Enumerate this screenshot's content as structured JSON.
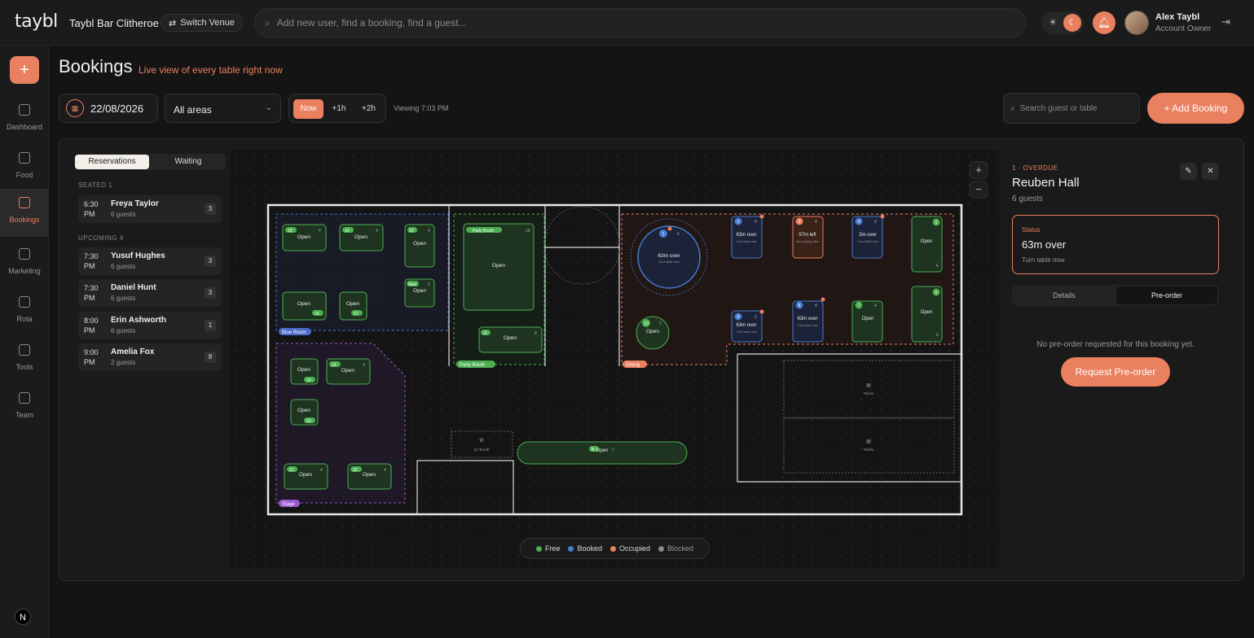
{
  "app": {
    "logo": "taybl",
    "venue": "Taybl Bar Clitheroe",
    "switch_label": "Switch Venue"
  },
  "search": {
    "placeholder": "Add new user, find a booking, find a guest..."
  },
  "user": {
    "name": "Alex Taybl",
    "role": "Account Owner"
  },
  "colors": {
    "accent": "#e9805f",
    "free": "#4caf50",
    "booked": "#4a7bd0",
    "occupied": "#e9805f",
    "blocked": "#888888"
  },
  "sidebar": {
    "add_label": "+",
    "items": [
      {
        "label": "Dashboard",
        "icon": "dashboard-icon"
      },
      {
        "label": "Food",
        "icon": "food-icon"
      },
      {
        "label": "Bookings",
        "icon": "bookings-icon",
        "active": true
      },
      {
        "label": "Marketing",
        "icon": "megaphone-icon"
      },
      {
        "label": "Rota",
        "icon": "rota-icon"
      },
      {
        "label": "Tools",
        "icon": "tools-icon"
      },
      {
        "label": "Team",
        "icon": "team-icon"
      }
    ],
    "bottom_badge": "N"
  },
  "page": {
    "title": "Bookings",
    "subtitle": "Live view of every table right now"
  },
  "toolbar": {
    "date": "22/08/2026",
    "area": "All areas",
    "times": [
      "Now",
      "+1h",
      "+2h"
    ],
    "viewing": "Viewing 7:03 PM",
    "search_placeholder": "Search guest or table",
    "add_booking": "+ Add Booking"
  },
  "reservations": {
    "tabs": [
      "Reservations",
      "Waiting"
    ],
    "seated_header": "SEATED 1",
    "upcoming_header": "UPCOMING 4",
    "seated": [
      {
        "time": "6:30 PM",
        "name": "Freya Taylor",
        "guests": "6 guests",
        "count": "3"
      }
    ],
    "upcoming": [
      {
        "time": "7:30 PM",
        "name": "Yusuf Hughes",
        "guests": "6 guests",
        "count": "3"
      },
      {
        "time": "7:30 PM",
        "name": "Daniel Hunt",
        "guests": "6 guests",
        "count": "3"
      },
      {
        "time": "8:00 PM",
        "name": "Erin Ashworth",
        "guests": "6 guests",
        "count": "1"
      },
      {
        "time": "9:00 PM",
        "name": "Amelia Fox",
        "guests": "2 guests",
        "count": "8"
      }
    ]
  },
  "floor": {
    "zones": {
      "blue": "Blue Room",
      "stage": "Stage",
      "party": "Party Booth",
      "dining": "Dining"
    },
    "tables": {
      "t15": {
        "num": "15",
        "label": "Open",
        "seats": "4"
      },
      "t14": {
        "num": "14",
        "label": "Open",
        "seats": "4"
      },
      "t13": {
        "num": "13",
        "label": "Open",
        "seats": "4"
      },
      "tnew": {
        "num": "New",
        "label": "Open",
        "seats": "2"
      },
      "t16": {
        "num": "16",
        "label": "Open"
      },
      "t17": {
        "num": "17",
        "label": "Open"
      },
      "tpb": {
        "num": "Party Booth",
        "label": "Open",
        "seats": "16"
      },
      "t11": {
        "num": "11",
        "label": "Open",
        "seats": "8"
      },
      "t18": {
        "num": "18",
        "label": "Open",
        "seats": "4"
      },
      "t19": {
        "num": "19",
        "label": "Open"
      },
      "t20": {
        "num": "20",
        "label": "Open"
      },
      "t21": {
        "num": "21",
        "label": "Open",
        "seats": "4"
      },
      "t22": {
        "num": "22",
        "label": "Open",
        "seats": "4"
      },
      "t1": {
        "num": "1",
        "label": "63m over",
        "sub": "Turn table now",
        "seats": "6"
      },
      "t10": {
        "num": "10",
        "label": "Open",
        "seats": "2"
      },
      "t2": {
        "num": "2",
        "label": "63m over",
        "sub": "Turn table now",
        "seats": "4"
      },
      "t3": {
        "num": "3",
        "label": "57m left",
        "sub": "No booking after",
        "seats": "4"
      },
      "t4": {
        "num": "4",
        "label": "3m over",
        "sub": "Turn table now",
        "seats": "4"
      },
      "t5": {
        "num": "5",
        "label": "Open",
        "seats": "6"
      },
      "t9": {
        "num": "9",
        "label": "63m over",
        "sub": "Turn table now",
        "seats": "2"
      },
      "t8": {
        "num": "8",
        "label": "63m over",
        "sub": "Turn table now",
        "seats": "4"
      },
      "t7": {
        "num": "7",
        "label": "Open",
        "seats": "4"
      },
      "t6": {
        "num": "6",
        "label": "Open",
        "seats": "6"
      },
      "bar": {
        "num": "B",
        "label": "Open",
        "seats": "1"
      }
    },
    "dj_booth": "DJ Booth",
    "toilets": "Toilets",
    "zoom_in": "+",
    "zoom_out": "−"
  },
  "legend": [
    {
      "label": "Free",
      "color": "#4caf50"
    },
    {
      "label": "Booked",
      "color": "#4a7bd0"
    },
    {
      "label": "Occupied",
      "color": "#e9805f"
    },
    {
      "label": "Blocked",
      "color": "#888888"
    }
  ],
  "detail": {
    "overdue": "1 · OVERDUE",
    "name": "Reuben Hall",
    "guests": "6 guests",
    "status_label": "Status",
    "status_value": "63m over",
    "status_sub": "Turn table now",
    "tabs": [
      "Details",
      "Pre-order"
    ],
    "no_preorder": "No pre-order requested for this booking yet.",
    "request_btn": "Request Pre-order"
  }
}
